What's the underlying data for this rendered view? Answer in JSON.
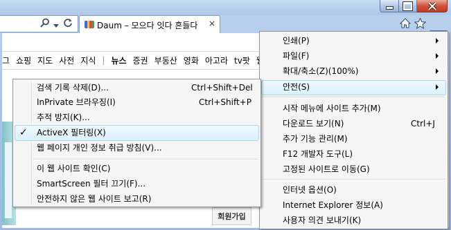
{
  "window": {
    "tab_title": "Daum – 모으다 잇다 흔들다",
    "tab_close": "×",
    "favicon_colors": [
      "#3a6fd8",
      "#f6c445",
      "#e8453c",
      "#35a853"
    ]
  },
  "page": {
    "top_nav": [
      "그",
      "쇼핑",
      "지도",
      "사전",
      "지식",
      "|",
      "뉴스",
      "증권",
      "부동산",
      "영화",
      "아고라",
      "tv팟",
      "웹"
    ],
    "member_button": "회원가입"
  },
  "tools_menu": {
    "items": [
      {
        "label": "인쇄(P)",
        "submenu": true
      },
      {
        "label": "파일(F)",
        "submenu": true
      },
      {
        "label": "확대/축소(Z)(100%)",
        "submenu": true
      },
      {
        "label": "안전(S)",
        "submenu": true,
        "highlighted": true
      },
      {
        "label": "시작 메뉴에 사이트 추가(M)"
      },
      {
        "label": "다운로드 보기(N)",
        "shortcut": "Ctrl+J"
      },
      {
        "label": "추가 기능 관리(M)"
      },
      {
        "label": "F12 개발자 도구(L)"
      },
      {
        "label": "고정된 사이트로 이동(G)"
      },
      {
        "label": "인터넷 옵션(O)"
      },
      {
        "label": "Internet Explorer 정보(A)"
      },
      {
        "label": "사용자 의견 보내기(K)"
      }
    ]
  },
  "safety_menu": {
    "items": [
      {
        "label": "검색 기록 삭제(D)...",
        "shortcut": "Ctrl+Shift+Del"
      },
      {
        "label": "InPrivate 브라우징(I)",
        "shortcut": "Ctrl+Shift+P"
      },
      {
        "label": "추적 방지(K)..."
      },
      {
        "label": "ActiveX 필터링(X)",
        "checked": true,
        "check": "✓"
      },
      {
        "label": "웹 페이지 개인 정보 취급 방침(V)..."
      },
      {
        "label": "이 웹 사이트 확인(C)"
      },
      {
        "label": "SmartScreen 필터 끄기(F)..."
      },
      {
        "label": "안전하지 않은 웹 사이트 보고(R)"
      }
    ]
  }
}
